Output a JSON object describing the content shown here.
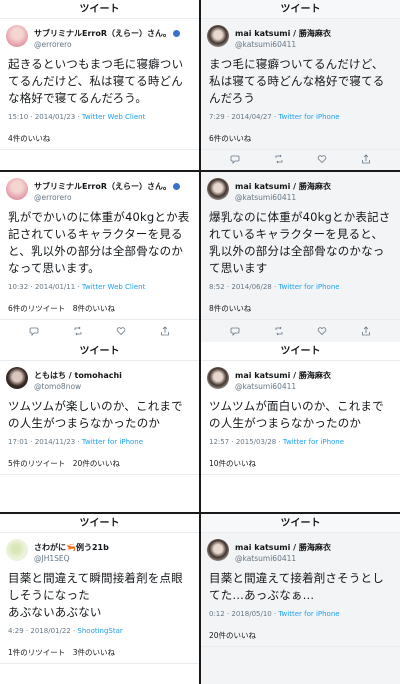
{
  "header_title": "ツイート",
  "panels": [
    {
      "user": "サブリミナルErroR（えらー）さん。",
      "handle": "@errorero",
      "text": "起きるといつもまつ毛に寝癖ついてるんだけど、私は寝てる時どんな格好で寝てるんだろう。",
      "time": "15:10 · 2014/01/23 · ",
      "source": "Twitter Web Client",
      "stats": "4件のいいね"
    },
    {
      "user": "mai katsumi / 勝海麻衣",
      "handle": "@katsumi60411",
      "text": "まつ毛に寝癖ついてるんだけど、私は寝てる時どんな格好で寝てるんだろう",
      "time": "7:29 · 2014/04/27 · ",
      "source": "Twitter for iPhone",
      "stats": "6件のいいね"
    },
    {
      "user": "サブリミナルErroR（えらー）さん。",
      "handle": "@errorero",
      "text": "乳がでかいのに体重が40kgとか表記されているキャラクターを見ると、乳以外の部分は全部骨なのかなって思います。",
      "time": "10:32 · 2014/01/11 · ",
      "source": "Twitter Web Client",
      "stats": "6件のリツイート　8件のいいね"
    },
    {
      "user": "mai katsumi / 勝海麻衣",
      "handle": "@katsumi60411",
      "text": "爆乳なのに体重が40kgとか表記されているキャラクターを見ると、乳以外の部分は全部骨なのかなって思います",
      "time": "8:52 · 2014/06/28 · ",
      "source": "Twitter for iPhone",
      "stats": "8件のいいね"
    },
    {
      "user": "ともはち / tomohachi",
      "handle": "@tomo8now",
      "text": "ツムツムが楽しいのか、これまでの人生がつまらなかったのか",
      "time": "17:01 · 2014/11/23 · ",
      "source": "Twitter for iPhone",
      "stats": "5件のリツイート　20件のいいね"
    },
    {
      "user": "mai katsumi / 勝海麻衣",
      "handle": "@katsumi60411",
      "text": "ツムツムが面白いのか、これまでの人生がつまらなかったのか",
      "time": "12:57 · 2015/03/28 · ",
      "source": "Twitter for iPhone",
      "stats": "10件のいいね"
    },
    {
      "user": "さわがに🦐例う21b",
      "handle": "@JH1SEQ",
      "text": "目薬と間違えて瞬間接着剤を点眼しそうになった\nあぶないあぶない",
      "time": "4:29 · 2018/01/22 · ",
      "source": "ShootingStar",
      "stats": "1件のリツイート　3件のいいね"
    },
    {
      "user": "mai katsumi / 勝海麻衣",
      "handle": "@katsumi60411",
      "text": "目薬と間違えて接着剤さそうとしてた…あっぶなぁ…",
      "time": "0:12 · 2018/05/10 · ",
      "source": "Twitter for iPhone",
      "stats": "20件のいいね"
    }
  ]
}
